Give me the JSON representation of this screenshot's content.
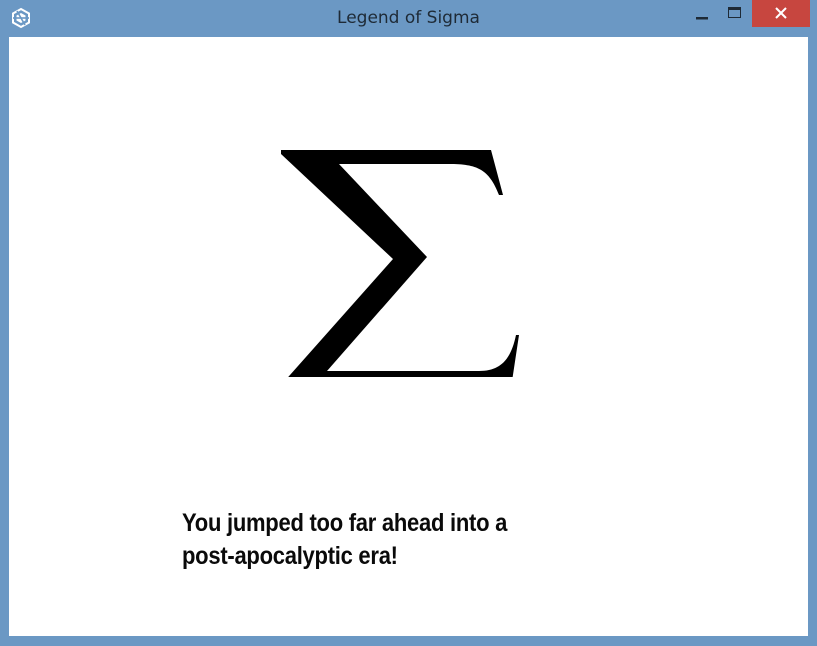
{
  "window": {
    "title": "Legend of Sigma",
    "icons": {
      "app": "unity-logo-icon",
      "minimize": "minimize-icon",
      "maximize": "maximize-icon",
      "close": "close-icon"
    },
    "colors": {
      "frame": "#6b98c4",
      "close_button": "#c7463f",
      "client_background": "#ffffff"
    }
  },
  "game": {
    "symbol": "Σ",
    "message_lines": [
      "You jumped too far ahead into a",
      "post-apocalyptic era!"
    ],
    "text_color": "#0a0a0a"
  }
}
